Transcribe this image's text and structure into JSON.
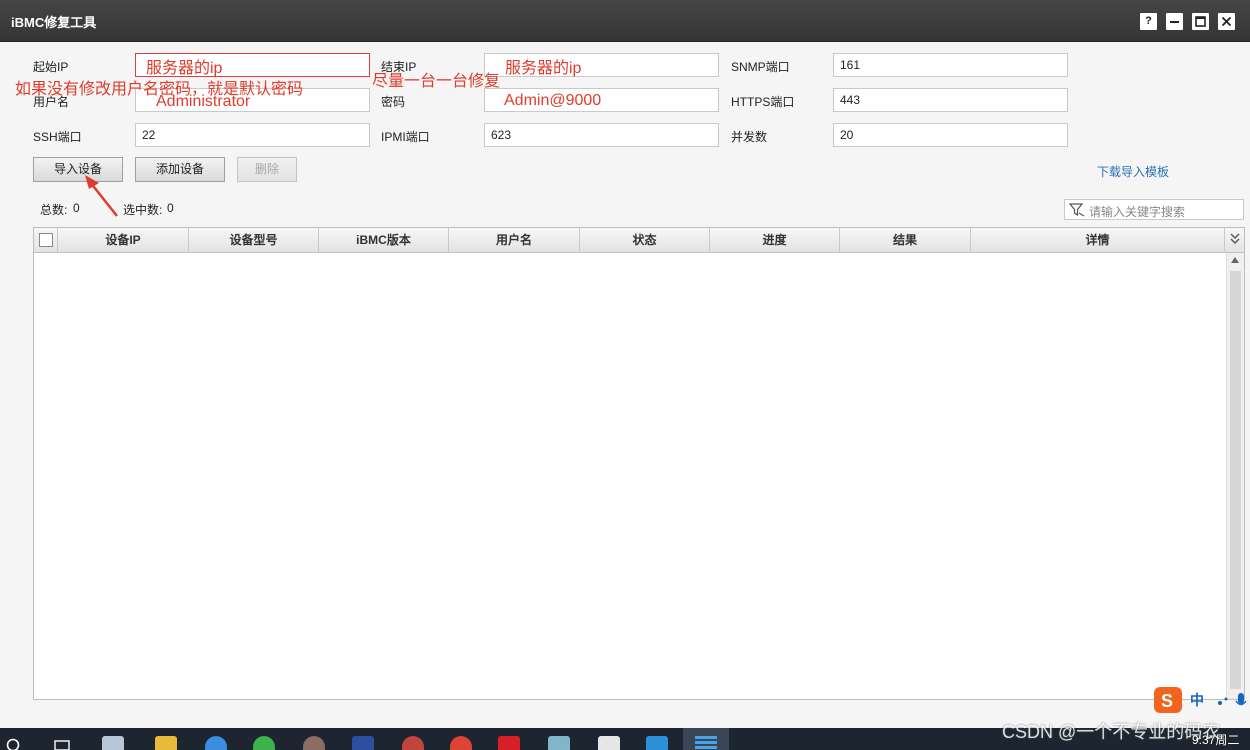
{
  "window": {
    "title": "iBMC修复工具",
    "controls": [
      "?",
      "−",
      "▢",
      "✕"
    ]
  },
  "form": {
    "start_ip_label": "起始IP",
    "start_ip_value": "",
    "end_ip_label": "结束IP",
    "end_ip_value": "",
    "snmp_port_label": "SNMP端口",
    "snmp_port_value": "161",
    "username_label": "用户名",
    "username_value": "",
    "password_label": "密码",
    "password_value": "",
    "https_port_label": "HTTPS端口",
    "https_port_value": "443",
    "ssh_port_label": "SSH端口",
    "ssh_port_value": "22",
    "ipmi_port_label": "IPMI端口",
    "ipmi_port_value": "623",
    "concurrency_label": "并发数",
    "concurrency_value": "20"
  },
  "annotations": {
    "start_ip_note": "服务器的ip",
    "end_ip_note": "服务器的ip",
    "one_by_one_note": "尽量一台一台修复",
    "default_password_note": "如果没有修改用户名密码，就是默认密码",
    "username_note": "Administrator",
    "password_note": "Admin@9000"
  },
  "toolbar": {
    "import_label": "导入设备",
    "add_label": "添加设备",
    "delete_label": "删除",
    "download_template_label": "下载导入模板"
  },
  "counts": {
    "total_label": "总数:",
    "total_value": "0",
    "selected_label": "选中数:",
    "selected_value": "0"
  },
  "search": {
    "placeholder": "请输入关键字搜索"
  },
  "table": {
    "columns": [
      "设备IP",
      "设备型号",
      "iBMC版本",
      "用户名",
      "状态",
      "进度",
      "结果",
      "详情"
    ],
    "rows": []
  },
  "taskbar": {
    "watermark": "CSDN @一个不专业的码农",
    "time": "9:37",
    "weekday": "周二",
    "ime_lang": "中"
  },
  "colors": {
    "accent_red": "#e03c2c",
    "link_blue": "#2a6fb8",
    "titlebar": "#3d3d3d"
  }
}
